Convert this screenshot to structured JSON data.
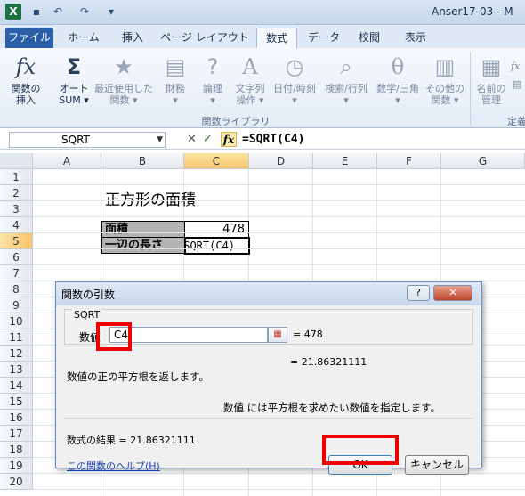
{
  "app": {
    "logo": "X",
    "window_title": "Anser17-03 - M",
    "quick_access": [
      "save-icon",
      "undo-icon",
      "redo-icon"
    ]
  },
  "tabs": [
    {
      "label": "ファイル",
      "state": "file"
    },
    {
      "label": "ホーム"
    },
    {
      "label": "挿入"
    },
    {
      "label": "ページ レイアウト"
    },
    {
      "label": "数式",
      "state": "active"
    },
    {
      "label": "データ"
    },
    {
      "label": "校閲"
    },
    {
      "label": "表示"
    }
  ],
  "ribbon": {
    "group_label": "関数ライブラリ",
    "buttons": [
      {
        "line1": "関数の",
        "line2": "挿入",
        "icon": "fx-icon",
        "glyph": "fx",
        "enabled": true
      },
      {
        "line1": "オート",
        "line2": "SUM ▾",
        "icon": "sigma-icon",
        "glyph": "Σ",
        "enabled": true
      },
      {
        "line1": "最近使用した",
        "line2": "関数 ▾",
        "icon": "star-book-icon",
        "glyph": "★",
        "enabled": false
      },
      {
        "line1": "財務",
        "line2": "▾",
        "icon": "finance-book-icon",
        "glyph": "▤",
        "enabled": false
      },
      {
        "line1": "論理",
        "line2": "▾",
        "icon": "logic-book-icon",
        "glyph": "?",
        "enabled": false
      },
      {
        "line1": "文字列",
        "line2": "操作 ▾",
        "icon": "text-book-icon",
        "glyph": "A",
        "enabled": false
      },
      {
        "line1": "日付/時刻",
        "line2": "▾",
        "icon": "clock-book-icon",
        "glyph": "◷",
        "enabled": false
      },
      {
        "line1": "検索/行列",
        "line2": "▾",
        "icon": "lookup-book-icon",
        "glyph": "⌕",
        "enabled": false
      },
      {
        "line1": "数学/三角",
        "line2": "▾",
        "icon": "math-book-icon",
        "glyph": "θ",
        "enabled": false
      },
      {
        "line1": "その他の",
        "line2": "関数 ▾",
        "icon": "more-book-icon",
        "glyph": "▥",
        "enabled": false
      }
    ],
    "names": {
      "line1": "名前の",
      "line2": "管理",
      "glyph": "▦"
    },
    "names_group_label": "定義",
    "side_icons": [
      "fx",
      "▤"
    ]
  },
  "formula_bar": {
    "name_box": "SQRT",
    "formula": "=SQRT(C4)",
    "cancel_glyph": "✕",
    "enter_glyph": "✓",
    "fx_glyph": "fx"
  },
  "grid": {
    "columns": [
      "A",
      "B",
      "C",
      "D",
      "E",
      "F",
      "G"
    ],
    "selected_column": "C",
    "rows": [
      "1",
      "2",
      "3",
      "4",
      "5",
      "6",
      "7",
      "8",
      "9",
      "10",
      "11",
      "12",
      "13",
      "14",
      "15",
      "16",
      "17",
      "18",
      "19",
      "20"
    ],
    "selected_row": "5"
  },
  "sheet": {
    "title": "正方形の面積",
    "area_label": "面積",
    "area_value": "478",
    "side_label": "一辺の長さ",
    "editing_text": "=SQRT(C4)"
  },
  "dialog": {
    "title": "関数の引数",
    "help_glyph": "?",
    "close_glyph": "✕",
    "function_name": "SQRT",
    "arg_label": "数値",
    "arg_value": "C4",
    "ref_icon": "range-select-icon",
    "arg_result": "=  478",
    "result_top": "=  21.86321111",
    "description": "数値の正の平方根を返します。",
    "arg_description": "数値  には平方根を求めたい数値を指定します。",
    "formula_result": "数式の結果 =  21.86321111",
    "help_link": "この関数のヘルプ(H)",
    "ok_label": "OK",
    "cancel_label": "キャンセル"
  },
  "colors": {
    "highlight": "#ee0000",
    "file_tab": "#2a5fa8",
    "selected_header": "#f6c66b",
    "label_cell": "#b3b3b3"
  }
}
